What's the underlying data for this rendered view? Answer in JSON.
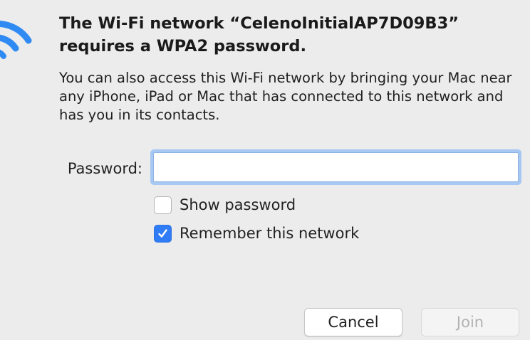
{
  "dialog": {
    "title": "The Wi-Fi network “CelenoInitialAP7D09B3” requires a WPA2 password.",
    "description": "You can also access this Wi-Fi network by bringing your Mac near any iPhone, iPad or Mac that has connected to this network and has you in its contacts.",
    "icon": "wifi-icon",
    "accent_color": "#2f7cf6"
  },
  "form": {
    "password_label": "Password:",
    "password_value": "",
    "password_placeholder": "",
    "show_password_label": "Show password",
    "show_password_checked": false,
    "remember_label": "Remember this network",
    "remember_checked": true
  },
  "buttons": {
    "cancel_label": "Cancel",
    "join_label": "Join",
    "join_enabled": false
  }
}
